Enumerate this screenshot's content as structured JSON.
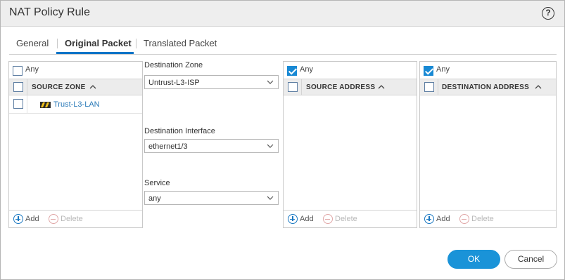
{
  "dialog": {
    "title": "NAT Policy Rule",
    "help_icon": "question-circle-icon",
    "help_glyph": "?"
  },
  "tabs": [
    {
      "label": "General",
      "active": false
    },
    {
      "label": "Original Packet",
      "active": true
    },
    {
      "label": "Translated Packet",
      "active": false
    }
  ],
  "source_zone": {
    "any_label": "Any",
    "any_checked": false,
    "column_header": "SOURCE ZONE",
    "rows": [
      {
        "label": "Trust-L3-LAN",
        "checked": false,
        "icon": "zone-icon"
      }
    ],
    "add_label": "Add",
    "delete_label": "Delete"
  },
  "destination": {
    "zone_label": "Destination Zone",
    "zone_value": "Untrust-L3-ISP",
    "interface_label": "Destination Interface",
    "interface_value": "ethernet1/3",
    "service_label": "Service",
    "service_value": "any"
  },
  "source_address": {
    "any_label": "Any",
    "any_checked": true,
    "column_header": "SOURCE ADDRESS",
    "add_label": "Add",
    "delete_label": "Delete"
  },
  "destination_address": {
    "any_label": "Any",
    "any_checked": true,
    "column_header": "DESTINATION ADDRESS",
    "add_label": "Add",
    "delete_label": "Delete"
  },
  "buttons": {
    "ok": "OK",
    "cancel": "Cancel"
  },
  "colors": {
    "accent": "#1a93d8",
    "link": "#2a7ab8",
    "tab_underline": "#0e74c7"
  }
}
